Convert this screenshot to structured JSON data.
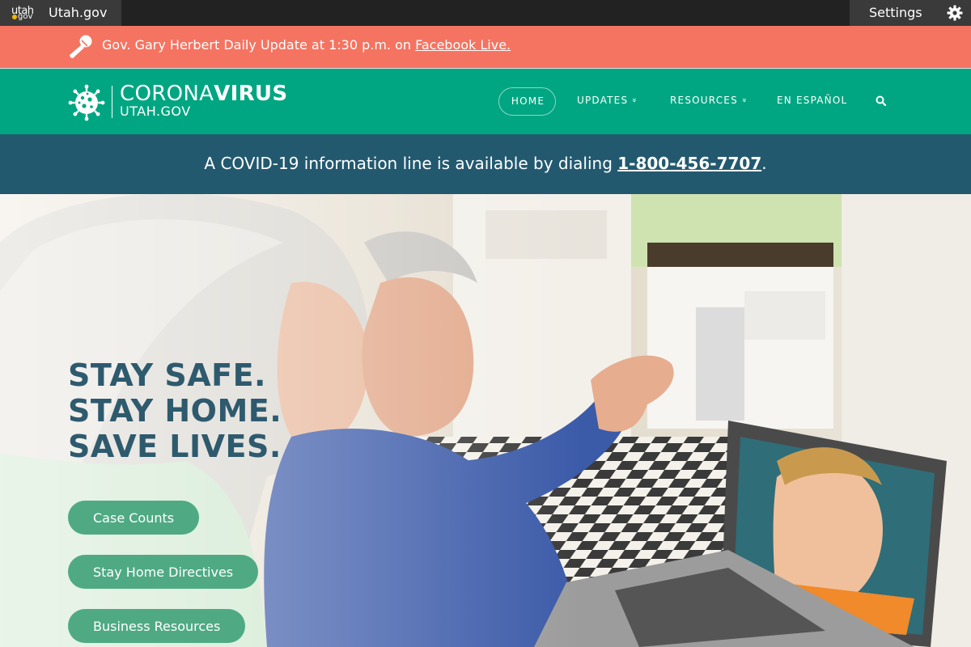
{
  "topbar": {
    "logo_line1": "utah",
    "logo_line2": "gov",
    "brand": "Utah.gov",
    "settings_label": "Settings"
  },
  "alert": {
    "text": "Gov. Gary Herbert Daily Update at 1:30 p.m. on ",
    "link": "Facebook Live."
  },
  "site": {
    "title_light": "CORONA",
    "title_bold": "VIRUS",
    "subtitle": "UTAH.GOV"
  },
  "nav": {
    "home": "HOME",
    "updates": "UPDATES",
    "resources": "RESOURCES",
    "espanol": "EN ESPAÑOL",
    "chevron": "»"
  },
  "info": {
    "text": "A COVID-19 information line is available by dialing ",
    "phone": "1-800-456-7707",
    "suffix": "."
  },
  "hero": {
    "headline": [
      "STAY SAFE.",
      "STAY HOME.",
      "SAVE LIVES."
    ],
    "buttons": [
      "Case Counts",
      "Stay Home Directives",
      "Business Resources"
    ]
  },
  "colors": {
    "alert": "#f47461",
    "nav": "#00a682",
    "info": "#23596f",
    "headline": "#2e5a6e",
    "button": "#4faa84"
  },
  "icons": [
    "microphone-icon",
    "gear-icon",
    "virus-logo-icon",
    "search-icon",
    "chevron-double-down-icon"
  ]
}
